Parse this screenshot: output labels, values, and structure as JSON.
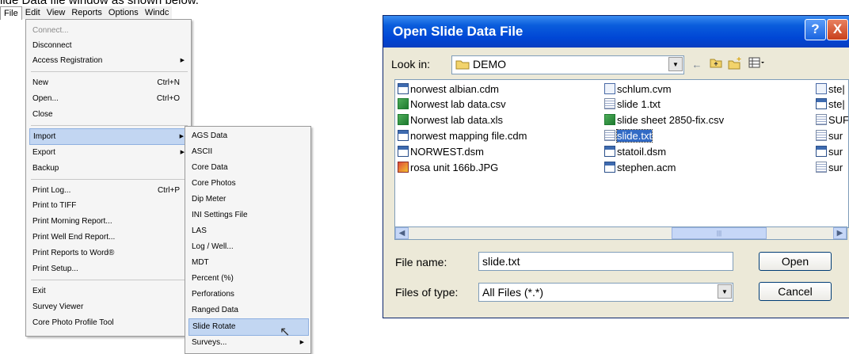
{
  "caption": "lide Data file window as shown below.",
  "menubar": {
    "items": [
      "File",
      "Edit",
      "View",
      "Reports",
      "Options",
      "Windc"
    ]
  },
  "file_menu": {
    "connect": "Connect...",
    "disconnect": "Disconnect",
    "access_registration": "Access Registration",
    "new": "New",
    "new_sc": "Ctrl+N",
    "open": "Open...",
    "open_sc": "Ctrl+O",
    "close": "Close",
    "import": "Import",
    "export": "Export",
    "backup": "Backup",
    "print_log": "Print Log...",
    "print_log_sc": "Ctrl+P",
    "print_tiff": "Print to TIFF",
    "print_morning": "Print Morning Report...",
    "print_well_end": "Print Well End Report...",
    "print_word": "Print Reports to Word®",
    "print_setup": "Print Setup...",
    "exit": "Exit",
    "survey_viewer": "Survey Viewer",
    "core_photo": "Core Photo Profile Tool"
  },
  "import_menu": {
    "items": [
      "AGS Data",
      "ASCII",
      "Core Data",
      "Core Photos",
      "Dip Meter",
      "INI Settings File",
      "LAS",
      "Log / Well...",
      "MDT",
      "Percent (%)",
      "Perforations",
      "Ranged Data",
      "Slide Rotate",
      "Surveys..."
    ]
  },
  "dialog": {
    "title": "Open Slide Data File",
    "help_glyph": "?",
    "close_glyph": "X",
    "look_in_label": "Look in:",
    "look_in_value": "DEMO",
    "files": [
      {
        "name": "norwest albian.cdm",
        "icon": "data"
      },
      {
        "name": "Norwest lab data.csv",
        "icon": "excel"
      },
      {
        "name": "Norwest lab data.xls",
        "icon": "excel"
      },
      {
        "name": "norwest mapping file.cdm",
        "icon": "data"
      },
      {
        "name": "NORWEST.dsm",
        "icon": "data"
      },
      {
        "name": "rosa unit 166b.JPG",
        "icon": "image"
      },
      {
        "name": "schlum.cvm",
        "icon": "cvm"
      },
      {
        "name": "slide 1.txt",
        "icon": "txt"
      },
      {
        "name": "slide sheet 2850-fix.csv",
        "icon": "excel"
      },
      {
        "name": "slide.txt",
        "icon": "txt",
        "selected": true
      },
      {
        "name": "statoil.dsm",
        "icon": "data"
      },
      {
        "name": "stephen.acm",
        "icon": "data"
      },
      {
        "name": "ste|",
        "icon": "cvm"
      },
      {
        "name": "ste|",
        "icon": "data"
      },
      {
        "name": "SUF",
        "icon": "txt"
      },
      {
        "name": "sur",
        "icon": "txt"
      },
      {
        "name": "sur",
        "icon": "data"
      },
      {
        "name": "sur",
        "icon": "txt"
      }
    ],
    "file_name_label": "File name:",
    "file_name_value": "slide.txt",
    "files_of_type_label": "Files of type:",
    "files_of_type_value": "All Files (*.*)",
    "open_button": "Open",
    "cancel_button": "Cancel"
  }
}
